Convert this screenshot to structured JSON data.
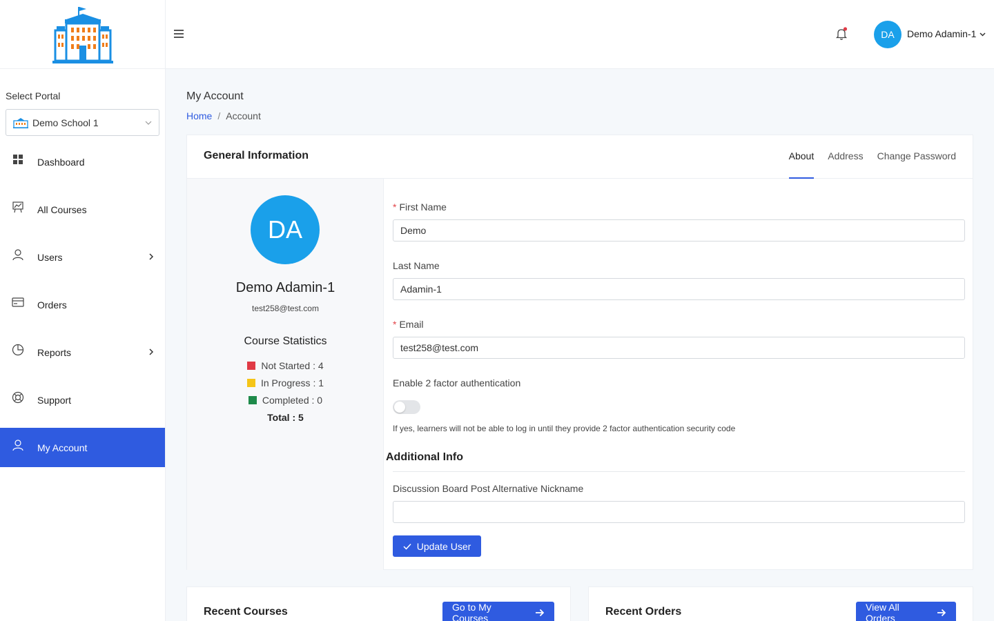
{
  "sidebar": {
    "portal_label": "Select Portal",
    "portal_value": "Demo School 1",
    "items": [
      {
        "label": "Dashboard",
        "icon": "grid-icon"
      },
      {
        "label": "All Courses",
        "icon": "presentation-icon"
      },
      {
        "label": "Users",
        "icon": "user-icon"
      },
      {
        "label": "Orders",
        "icon": "card-icon"
      },
      {
        "label": "Reports",
        "icon": "pie-chart-icon"
      },
      {
        "label": "Support",
        "icon": "lifebuoy-icon"
      },
      {
        "label": "My Account",
        "icon": "user-icon"
      }
    ]
  },
  "header": {
    "avatar_initials": "DA",
    "user_name": "Demo Adamin-1"
  },
  "page": {
    "title": "My Account",
    "breadcrumb_home": "Home",
    "breadcrumb_sep": "/",
    "breadcrumb_current": "Account"
  },
  "card": {
    "title": "General Information",
    "tabs": [
      "About",
      "Address",
      "Change Password"
    ]
  },
  "profile": {
    "initials": "DA",
    "name": "Demo Adamin-1",
    "email": "test258@test.com",
    "stats_title": "Course Statistics",
    "stats": [
      {
        "label": "Not Started : 4",
        "color": "#e03a45"
      },
      {
        "label": "In Progress : 1",
        "color": "#f5c518"
      },
      {
        "label": "Completed : 0",
        "color": "#1e8a4a"
      }
    ],
    "total": "Total : 5"
  },
  "form": {
    "first_name_label": "First Name",
    "first_name_value": "Demo",
    "last_name_label": "Last Name",
    "last_name_value": "Adamin-1",
    "email_label": "Email",
    "email_value": "test258@test.com",
    "twofa_label": "Enable 2 factor authentication",
    "twofa_help": "If yes, learners will not be able to log in until they provide 2 factor authentication security code",
    "additional_title": "Additional Info",
    "nickname_label": "Discussion Board Post Alternative Nickname",
    "nickname_value": "",
    "update_button": "Update User"
  },
  "bottom": {
    "recent_courses": "Recent Courses",
    "go_courses": "Go to My Courses",
    "recent_orders": "Recent Orders",
    "view_orders": "View All Orders"
  },
  "colors": {
    "accent": "#2f5be0",
    "avatar": "#1aa0ea"
  }
}
